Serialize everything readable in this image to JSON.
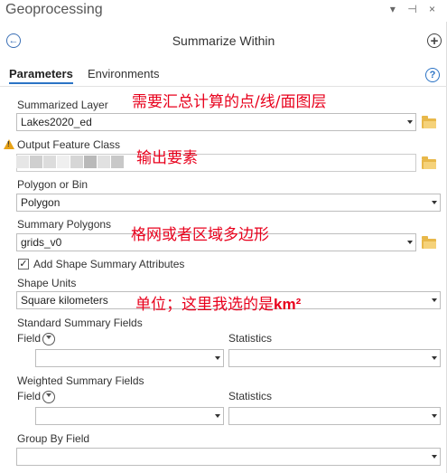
{
  "pane": {
    "title": "Geoprocessing",
    "controls": "▾ ⊣ ×"
  },
  "tool": {
    "title": "Summarize Within"
  },
  "tabs": {
    "parameters": "Parameters",
    "environments": "Environments"
  },
  "help": "?",
  "params": {
    "summarized_layer": {
      "label": "Summarized Layer",
      "value": "Lakes2020_ed"
    },
    "output_feature_class": {
      "label": "Output Feature Class",
      "value": ""
    },
    "polygon_or_bin": {
      "label": "Polygon or Bin",
      "value": "Polygon"
    },
    "summary_polygons": {
      "label": "Summary Polygons",
      "value": "grids_v0"
    },
    "add_shape_summary": {
      "label": "Add Shape Summary Attributes",
      "checked": true
    },
    "shape_units": {
      "label": "Shape Units",
      "value": "Square kilometers"
    },
    "standard_summary_fields": {
      "label": "Standard Summary Fields",
      "field_label": "Field",
      "statistics_label": "Statistics"
    },
    "weighted_summary_fields": {
      "label": "Weighted Summary Fields",
      "field_label": "Field",
      "statistics_label": "Statistics"
    },
    "group_by_field": {
      "label": "Group By Field",
      "value": ""
    }
  },
  "annotations": {
    "summarized": "需要汇总计算的点/线/面图层",
    "output": "输出要素",
    "polygons": "格网或者区域多边形",
    "units_prefix": "单位；这里我选的是",
    "units_bold": "km²"
  },
  "colors": {
    "accent": "#2b73c5",
    "annotation": "#e8001c",
    "folder": "#e8b84a",
    "warning": "#e8a317"
  }
}
